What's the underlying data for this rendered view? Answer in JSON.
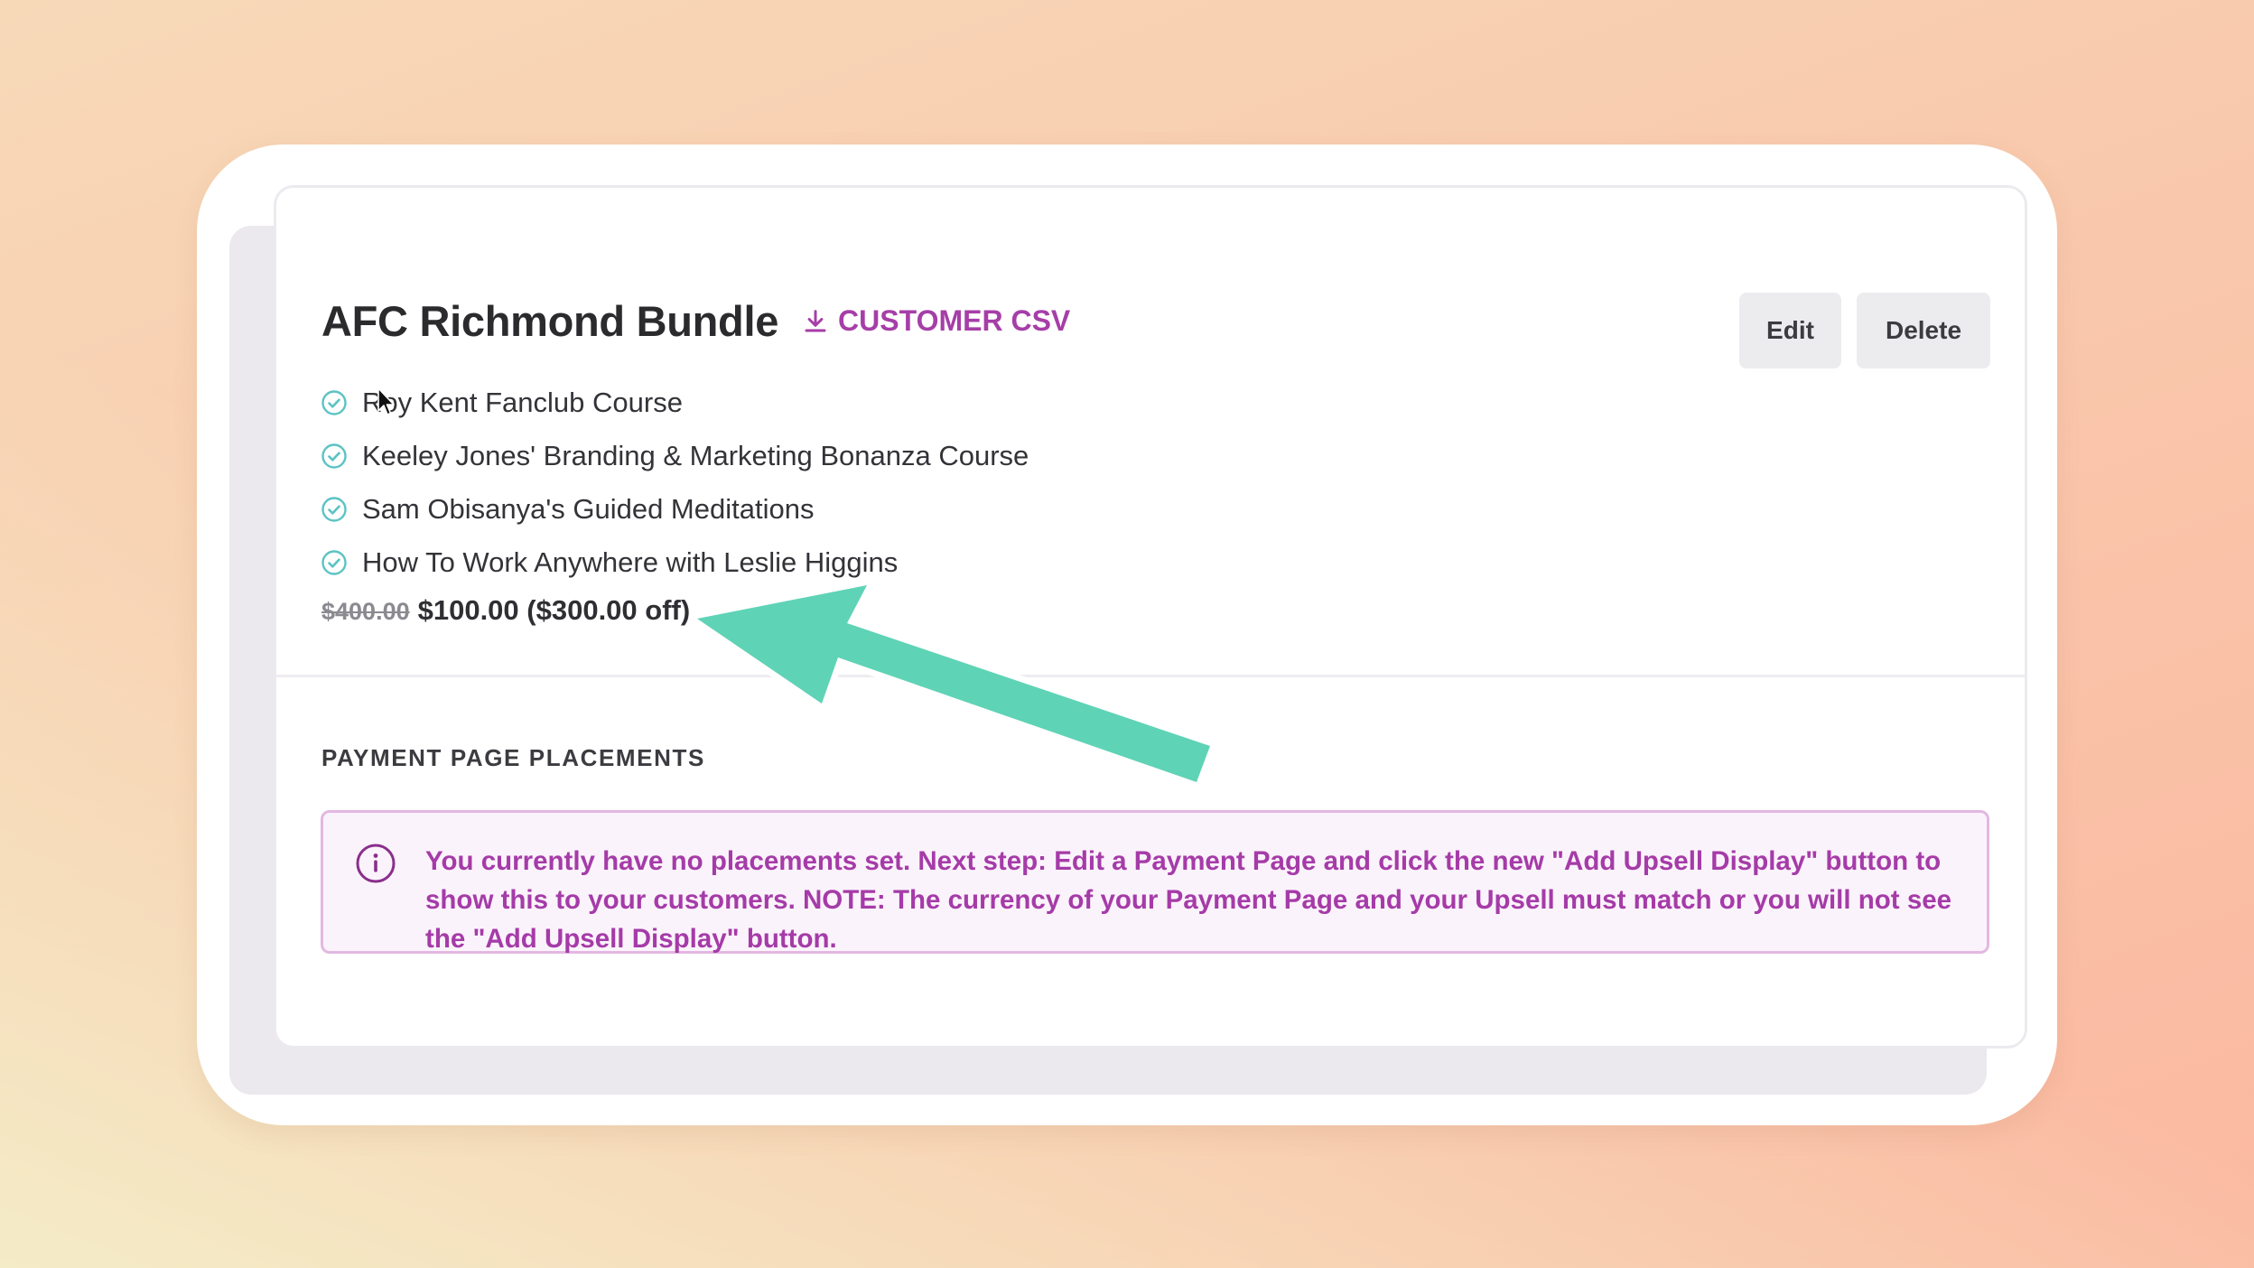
{
  "bundle": {
    "title": "AFC Richmond Bundle",
    "csv_label": "CUSTOMER CSV",
    "edit_label": "Edit",
    "delete_label": "Delete",
    "courses": [
      {
        "label": "Roy Kent Fanclub Course"
      },
      {
        "label": "Keeley Jones' Branding & Marketing Bonanza Course"
      },
      {
        "label": "Sam Obisanya's Guided Meditations"
      },
      {
        "label": "How To Work Anywhere with Leslie Higgins"
      }
    ],
    "original_price": "$400.00",
    "sale_price": "$100.00 ($300.00 off)"
  },
  "placements": {
    "section_title": "PAYMENT PAGE PLACEMENTS",
    "notice": "You currently have no placements set. Next step: Edit a Payment Page and click the new \"Add Upsell Display\" button to show this to your customers. NOTE: The currency of your Payment Page and your Upsell must match or you will not see the \"Add Upsell Display\" button."
  },
  "colors": {
    "accent": "#a63ea8",
    "check": "#5cc3c4",
    "arrow": "#5fd3b6",
    "notice_bg": "#fbf3fb",
    "notice_border": "#e2b8e1"
  },
  "icons": {
    "csv": "download-icon",
    "course": "check-circle-icon",
    "notice": "info-icon",
    "annotation": "arrow-icon",
    "pointer": "cursor-icon"
  }
}
